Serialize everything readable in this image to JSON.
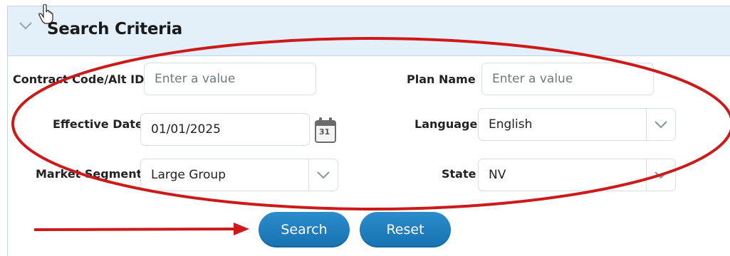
{
  "panel": {
    "title": "Search Criteria"
  },
  "fields": {
    "contract_code": {
      "label": "Contract Code/Alt ID",
      "placeholder": "Enter a value",
      "value": ""
    },
    "plan_name": {
      "label": "Plan Name",
      "placeholder": "Enter a value",
      "value": ""
    },
    "effective_date": {
      "label": "Effective Date",
      "value": "01/01/2025",
      "calendar_day": "31"
    },
    "language": {
      "label": "Language",
      "value": "English"
    },
    "market_segment": {
      "label": "Market Segment",
      "value": "Large Group"
    },
    "state": {
      "label": "State",
      "value": "NV"
    }
  },
  "buttons": {
    "search": "Search",
    "reset": "Reset"
  },
  "annotations": {
    "ellipse_color": "#cc1a1a",
    "arrow_color": "#cc1a1a"
  },
  "colors": {
    "header_bg": "#e3f0fa",
    "button_blue": "#1f7fc0"
  }
}
